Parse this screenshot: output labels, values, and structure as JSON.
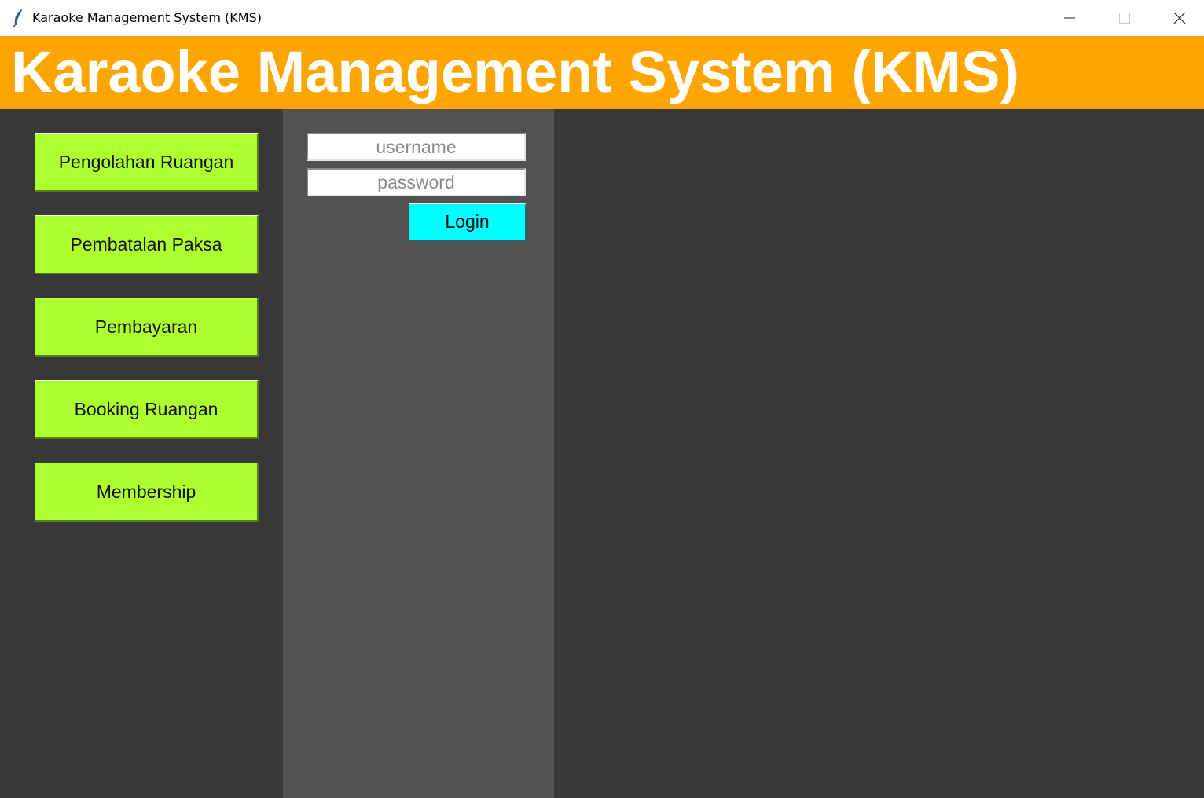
{
  "window": {
    "title": "Karaoke Management System (KMS)",
    "icon": "feather-icon"
  },
  "header": {
    "title": "Karaoke Management System (KMS)"
  },
  "sidebar": {
    "items": [
      {
        "label": "Pengolahan Ruangan"
      },
      {
        "label": "Pembatalan Paksa"
      },
      {
        "label": "Pembayaran"
      },
      {
        "label": "Booking Ruangan"
      },
      {
        "label": "Membership"
      }
    ]
  },
  "login": {
    "username_placeholder": "username",
    "username_value": "",
    "password_placeholder": "password",
    "password_value": "",
    "button_label": "Login"
  },
  "colors": {
    "banner": "#ffa500",
    "menu_button": "#adff2f",
    "login_button": "#00ffff",
    "background": "#383838",
    "login_panel": "#525252"
  }
}
